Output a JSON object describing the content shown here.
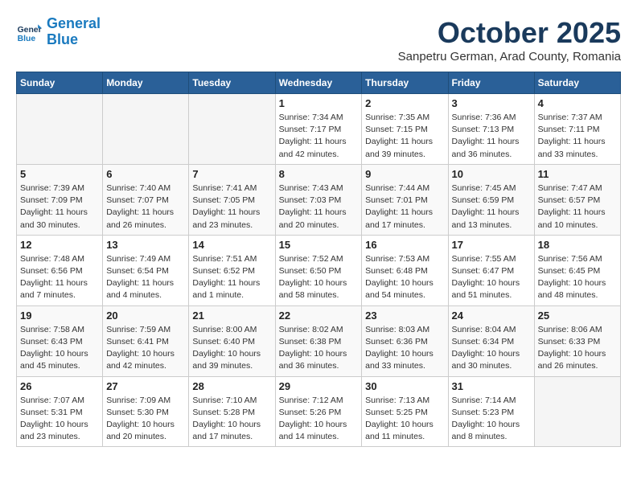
{
  "logo": {
    "line1": "General",
    "line2": "Blue"
  },
  "title": "October 2025",
  "location": "Sanpetru German, Arad County, Romania",
  "weekdays": [
    "Sunday",
    "Monday",
    "Tuesday",
    "Wednesday",
    "Thursday",
    "Friday",
    "Saturday"
  ],
  "weeks": [
    [
      {
        "day": "",
        "info": ""
      },
      {
        "day": "",
        "info": ""
      },
      {
        "day": "",
        "info": ""
      },
      {
        "day": "1",
        "info": "Sunrise: 7:34 AM\nSunset: 7:17 PM\nDaylight: 11 hours and 42 minutes."
      },
      {
        "day": "2",
        "info": "Sunrise: 7:35 AM\nSunset: 7:15 PM\nDaylight: 11 hours and 39 minutes."
      },
      {
        "day": "3",
        "info": "Sunrise: 7:36 AM\nSunset: 7:13 PM\nDaylight: 11 hours and 36 minutes."
      },
      {
        "day": "4",
        "info": "Sunrise: 7:37 AM\nSunset: 7:11 PM\nDaylight: 11 hours and 33 minutes."
      }
    ],
    [
      {
        "day": "5",
        "info": "Sunrise: 7:39 AM\nSunset: 7:09 PM\nDaylight: 11 hours and 30 minutes."
      },
      {
        "day": "6",
        "info": "Sunrise: 7:40 AM\nSunset: 7:07 PM\nDaylight: 11 hours and 26 minutes."
      },
      {
        "day": "7",
        "info": "Sunrise: 7:41 AM\nSunset: 7:05 PM\nDaylight: 11 hours and 23 minutes."
      },
      {
        "day": "8",
        "info": "Sunrise: 7:43 AM\nSunset: 7:03 PM\nDaylight: 11 hours and 20 minutes."
      },
      {
        "day": "9",
        "info": "Sunrise: 7:44 AM\nSunset: 7:01 PM\nDaylight: 11 hours and 17 minutes."
      },
      {
        "day": "10",
        "info": "Sunrise: 7:45 AM\nSunset: 6:59 PM\nDaylight: 11 hours and 13 minutes."
      },
      {
        "day": "11",
        "info": "Sunrise: 7:47 AM\nSunset: 6:57 PM\nDaylight: 11 hours and 10 minutes."
      }
    ],
    [
      {
        "day": "12",
        "info": "Sunrise: 7:48 AM\nSunset: 6:56 PM\nDaylight: 11 hours and 7 minutes."
      },
      {
        "day": "13",
        "info": "Sunrise: 7:49 AM\nSunset: 6:54 PM\nDaylight: 11 hours and 4 minutes."
      },
      {
        "day": "14",
        "info": "Sunrise: 7:51 AM\nSunset: 6:52 PM\nDaylight: 11 hours and 1 minute."
      },
      {
        "day": "15",
        "info": "Sunrise: 7:52 AM\nSunset: 6:50 PM\nDaylight: 10 hours and 58 minutes."
      },
      {
        "day": "16",
        "info": "Sunrise: 7:53 AM\nSunset: 6:48 PM\nDaylight: 10 hours and 54 minutes."
      },
      {
        "day": "17",
        "info": "Sunrise: 7:55 AM\nSunset: 6:47 PM\nDaylight: 10 hours and 51 minutes."
      },
      {
        "day": "18",
        "info": "Sunrise: 7:56 AM\nSunset: 6:45 PM\nDaylight: 10 hours and 48 minutes."
      }
    ],
    [
      {
        "day": "19",
        "info": "Sunrise: 7:58 AM\nSunset: 6:43 PM\nDaylight: 10 hours and 45 minutes."
      },
      {
        "day": "20",
        "info": "Sunrise: 7:59 AM\nSunset: 6:41 PM\nDaylight: 10 hours and 42 minutes."
      },
      {
        "day": "21",
        "info": "Sunrise: 8:00 AM\nSunset: 6:40 PM\nDaylight: 10 hours and 39 minutes."
      },
      {
        "day": "22",
        "info": "Sunrise: 8:02 AM\nSunset: 6:38 PM\nDaylight: 10 hours and 36 minutes."
      },
      {
        "day": "23",
        "info": "Sunrise: 8:03 AM\nSunset: 6:36 PM\nDaylight: 10 hours and 33 minutes."
      },
      {
        "day": "24",
        "info": "Sunrise: 8:04 AM\nSunset: 6:34 PM\nDaylight: 10 hours and 30 minutes."
      },
      {
        "day": "25",
        "info": "Sunrise: 8:06 AM\nSunset: 6:33 PM\nDaylight: 10 hours and 26 minutes."
      }
    ],
    [
      {
        "day": "26",
        "info": "Sunrise: 7:07 AM\nSunset: 5:31 PM\nDaylight: 10 hours and 23 minutes."
      },
      {
        "day": "27",
        "info": "Sunrise: 7:09 AM\nSunset: 5:30 PM\nDaylight: 10 hours and 20 minutes."
      },
      {
        "day": "28",
        "info": "Sunrise: 7:10 AM\nSunset: 5:28 PM\nDaylight: 10 hours and 17 minutes."
      },
      {
        "day": "29",
        "info": "Sunrise: 7:12 AM\nSunset: 5:26 PM\nDaylight: 10 hours and 14 minutes."
      },
      {
        "day": "30",
        "info": "Sunrise: 7:13 AM\nSunset: 5:25 PM\nDaylight: 10 hours and 11 minutes."
      },
      {
        "day": "31",
        "info": "Sunrise: 7:14 AM\nSunset: 5:23 PM\nDaylight: 10 hours and 8 minutes."
      },
      {
        "day": "",
        "info": ""
      }
    ]
  ]
}
